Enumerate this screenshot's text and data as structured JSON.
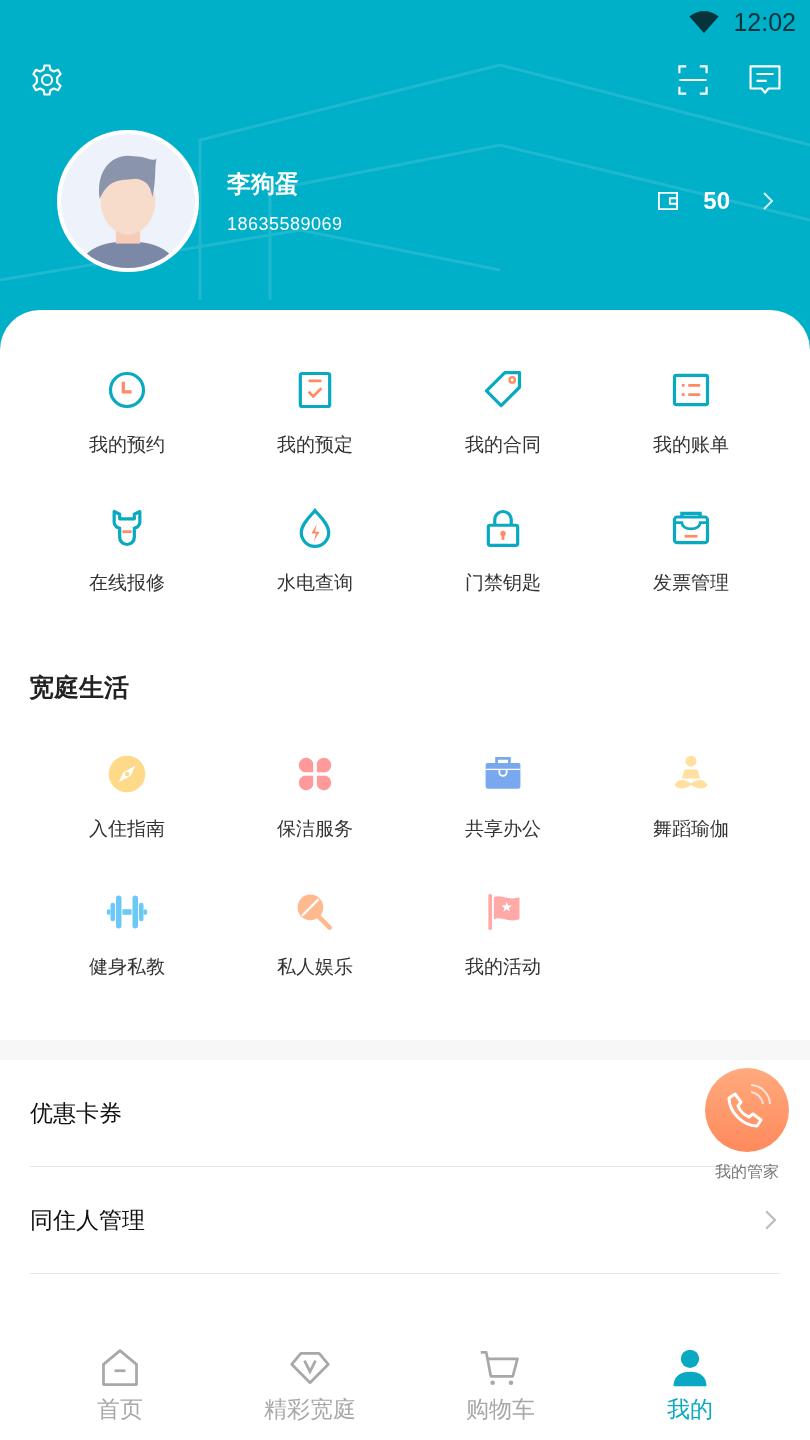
{
  "status_bar": {
    "time": "12:02"
  },
  "profile": {
    "name": "李狗蛋",
    "phone": "18635589069",
    "balance": "50"
  },
  "services": [
    {
      "label": "我的预约"
    },
    {
      "label": "我的预定"
    },
    {
      "label": "我的合同"
    },
    {
      "label": "我的账单"
    },
    {
      "label": "在线报修"
    },
    {
      "label": "水电查询"
    },
    {
      "label": "门禁钥匙"
    },
    {
      "label": "发票管理"
    }
  ],
  "life": {
    "title": "宽庭生活",
    "items": [
      {
        "label": "入住指南"
      },
      {
        "label": "保洁服务"
      },
      {
        "label": "共享办公"
      },
      {
        "label": "舞蹈瑜伽"
      },
      {
        "label": "健身私教"
      },
      {
        "label": "私人娱乐"
      },
      {
        "label": "我的活动"
      }
    ]
  },
  "menu": [
    {
      "label": "优惠卡券",
      "chevron": false
    },
    {
      "label": "同住人管理",
      "chevron": true
    }
  ],
  "butler": {
    "label": "我的管家"
  },
  "tabs": [
    {
      "label": "首页",
      "selected": false
    },
    {
      "label": "精彩宽庭",
      "selected": false
    },
    {
      "label": "购物车",
      "selected": false
    },
    {
      "label": "我的",
      "selected": true
    }
  ]
}
